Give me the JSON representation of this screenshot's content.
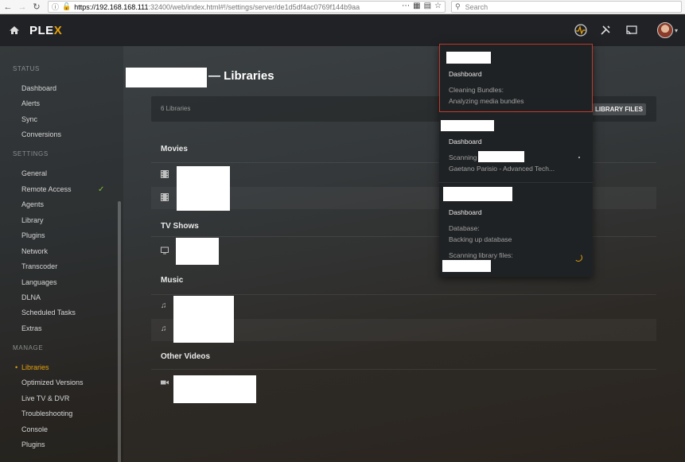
{
  "browser": {
    "url_host": "https://192.168.168.111",
    "url_rest": ":32400/web/index.html#!/settings/server/de1d5df4ac0769f144b9aa",
    "search_placeholder": "Search"
  },
  "header": {
    "logo_main": "PLE",
    "logo_x": "X"
  },
  "sidebar": {
    "status_heading": "STATUS",
    "status_items": [
      "Dashboard",
      "Alerts",
      "Sync",
      "Conversions"
    ],
    "settings_heading": "SETTINGS",
    "settings_items": [
      "General",
      "Remote Access",
      "Agents",
      "Library",
      "Plugins",
      "Network",
      "Transcoder",
      "Languages",
      "DLNA",
      "Scheduled Tasks",
      "Extras"
    ],
    "manage_heading": "MANAGE",
    "manage_bullet": "•",
    "manage_items": [
      "Libraries",
      "Optimized Versions",
      "Live TV & DVR",
      "Troubleshooting",
      "Console",
      "Plugins"
    ],
    "active_item": "Libraries"
  },
  "content": {
    "title_prefix": "— ",
    "title": "Libraries",
    "library_count": "6 Libraries",
    "library_files_button": "LIBRARY FILES",
    "sections": [
      "Movies",
      "TV Shows",
      "Music",
      "Other Videos"
    ]
  },
  "activity": {
    "items": [
      {
        "label": "Dashboard",
        "lines": [
          "Cleaning Bundles:",
          "Analyzing media bundles"
        ]
      },
      {
        "label": "Dashboard",
        "lines": [
          "Scanning",
          "Gaetano Parisio - Advanced Tech..."
        ]
      },
      {
        "label": "Dashboard",
        "lines": [
          "Database:",
          "Backing up database",
          "Scanning library files:"
        ]
      }
    ]
  },
  "colors": {
    "accent": "#e5a00d",
    "selected_border": "#c0392b",
    "check": "#7fc13a"
  }
}
